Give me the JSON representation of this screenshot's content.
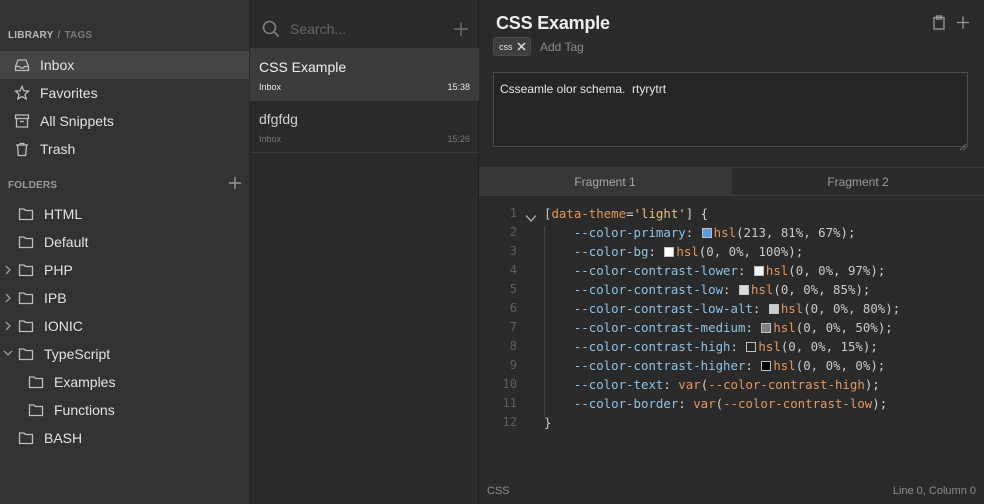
{
  "sidebar": {
    "header": {
      "library": "LIBRARY",
      "separator": "/",
      "tags": "TAGS"
    },
    "library_items": [
      {
        "label": "Inbox",
        "icon": "inbox-icon",
        "active": true
      },
      {
        "label": "Favorites",
        "icon": "star-icon"
      },
      {
        "label": "All Snippets",
        "icon": "archive-icon"
      },
      {
        "label": "Trash",
        "icon": "trash-icon"
      }
    ],
    "folders_title": "FOLDERS",
    "folders": [
      {
        "label": "HTML"
      },
      {
        "label": "Default"
      },
      {
        "label": "PHP",
        "expandable": true
      },
      {
        "label": "IPB",
        "expandable": true
      },
      {
        "label": "IONIC",
        "expandable": true
      },
      {
        "label": "TypeScript",
        "expanded": true
      },
      {
        "label": "Examples",
        "child": true
      },
      {
        "label": "Functions",
        "child": true
      },
      {
        "label": "BASH"
      }
    ]
  },
  "list": {
    "search_placeholder": "Search...",
    "snippets": [
      {
        "title": "CSS Example",
        "folder": "Inbox",
        "time": "15:38",
        "active": true
      },
      {
        "title": "dfgfdg",
        "folder": "Inbox",
        "time": "15:26"
      }
    ]
  },
  "editor": {
    "title": "CSS Example",
    "tag": "css",
    "add_tag_placeholder": "Add Tag",
    "description": "Csseamle olor schema.  rtyrytrt",
    "fragments": [
      "Fragment 1",
      "Fragment 2"
    ],
    "code": {
      "open_selector_attr": "data-theme",
      "open_selector_value": "'light'",
      "lines": [
        {
          "prop": "--color-primary",
          "swatch": "#5b9be6",
          "fn": "hsl",
          "args": "213, 81%, 67%"
        },
        {
          "prop": "--color-bg",
          "swatch": "#ffffff",
          "fn": "hsl",
          "args": "0, 0%, 100%"
        },
        {
          "prop": "--color-contrast-lower",
          "swatch": "#f7f7f7",
          "fn": "hsl",
          "args": "0, 0%, 97%"
        },
        {
          "prop": "--color-contrast-low",
          "swatch": "#d9d9d9",
          "fn": "hsl",
          "args": "0, 0%, 85%"
        },
        {
          "prop": "--color-contrast-low-alt",
          "swatch": "#cccccc",
          "fn": "hsl",
          "args": "0, 0%, 80%"
        },
        {
          "prop": "--color-contrast-medium",
          "swatch": "#808080",
          "fn": "hsl",
          "args": "0, 0%, 50%"
        },
        {
          "prop": "--color-contrast-high",
          "swatch": "#262626",
          "fn": "hsl",
          "args": "0, 0%, 15%"
        },
        {
          "prop": "--color-contrast-higher",
          "swatch": "#000000",
          "fn": "hsl",
          "args": "0, 0%, 0%"
        },
        {
          "prop": "--color-text",
          "fn": "var",
          "args": "--color-contrast-high"
        },
        {
          "prop": "--color-border",
          "fn": "var",
          "args": "--color-contrast-low"
        }
      ],
      "close": "}"
    }
  },
  "statusbar": {
    "language": "CSS",
    "position": "Line 0, Column 0"
  }
}
